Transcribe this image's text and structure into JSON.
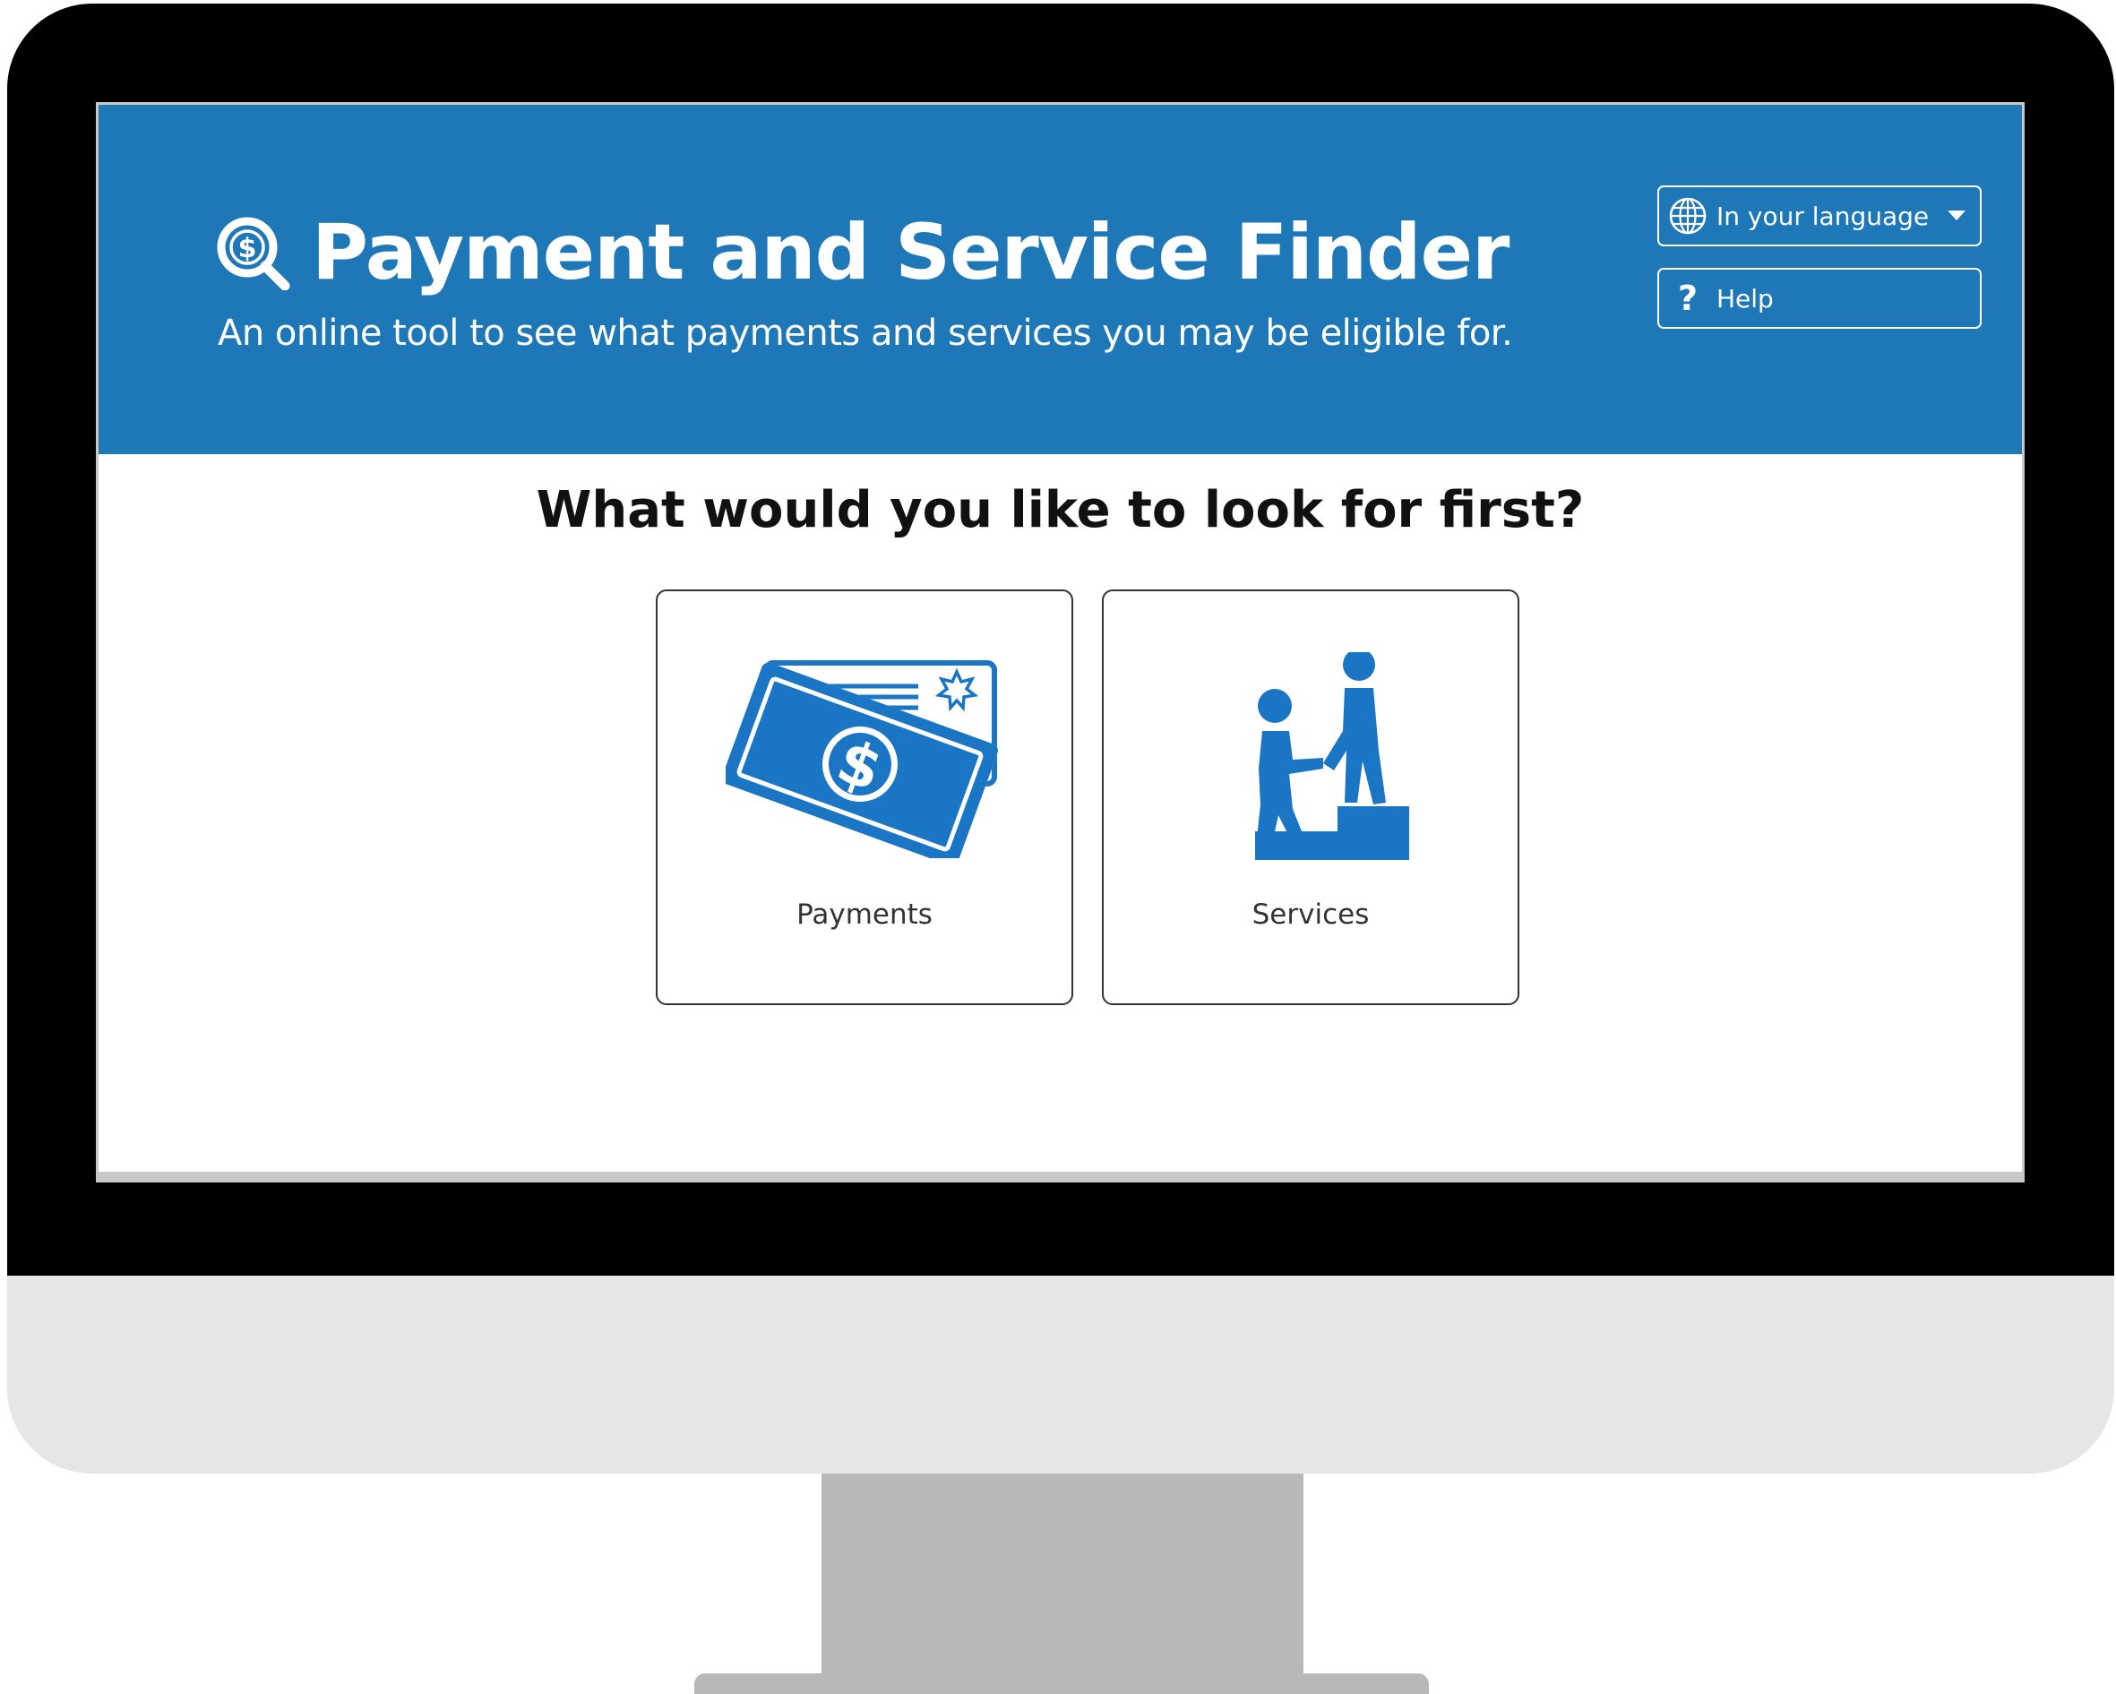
{
  "app": {
    "title": "Payment and Service Finder",
    "subtitle": "An online tool to see what payments and services you may be eligible for.",
    "logo_icon": "dollar-search-icon"
  },
  "header_actions": {
    "language_label": "In your language",
    "language_icon": "globe-icon",
    "help_label": "Help",
    "help_icon": "question-mark-icon"
  },
  "main": {
    "question": "What would you like to look for first?",
    "options": [
      {
        "label": "Payments",
        "icon": "money-bills-icon"
      },
      {
        "label": "Services",
        "icon": "helping-hand-step-icon"
      }
    ]
  },
  "colors": {
    "header_bg": "#1e78b8",
    "icon_blue": "#1a75c4",
    "bezel": "#000000",
    "chin": "#e6e6e6",
    "stand": "#b8b8b8"
  }
}
